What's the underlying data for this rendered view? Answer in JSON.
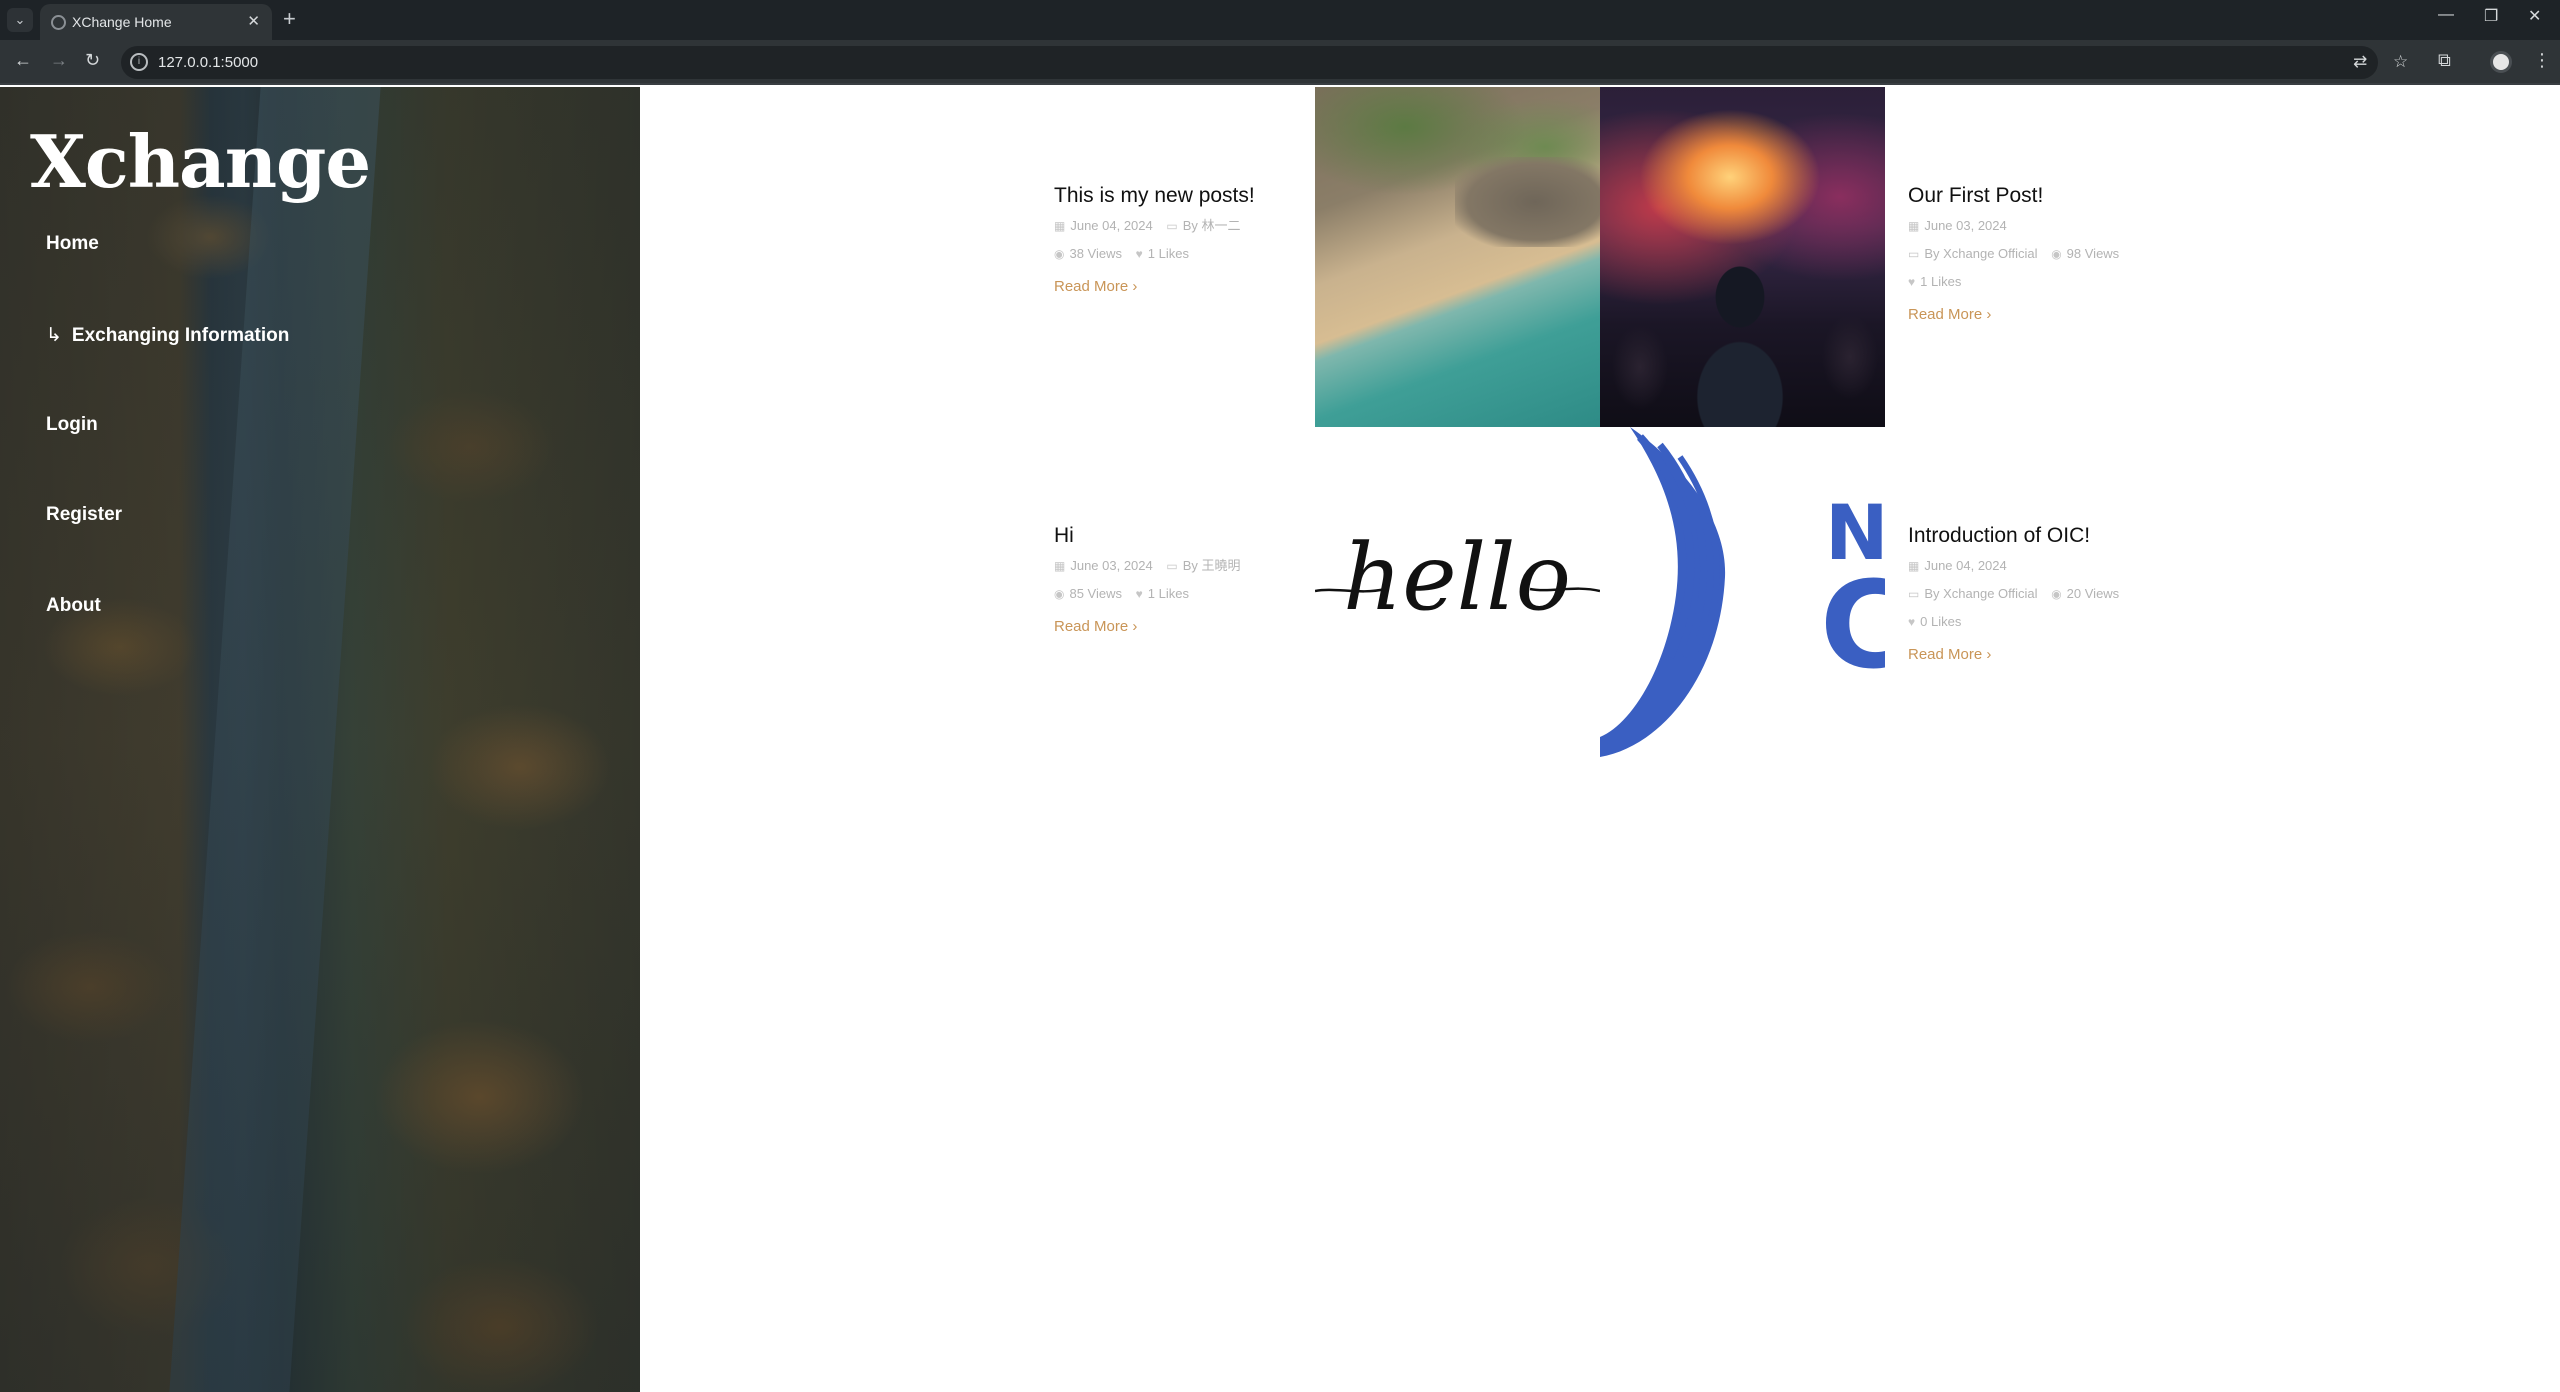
{
  "browser": {
    "tab_title": "XChange Home",
    "url": "127.0.0.1:5000"
  },
  "sidebar": {
    "brand": "Xchange",
    "nav": [
      {
        "label": "Home"
      },
      {
        "label": "Exchanging Information",
        "prefix": "↳"
      },
      {
        "label": "Login"
      },
      {
        "label": "Register"
      },
      {
        "label": "About"
      }
    ]
  },
  "posts": [
    {
      "title": "This is my new posts!",
      "date": "June 04, 2024",
      "author": "By 林一二",
      "views": "38 Views",
      "likes": "1 Likes",
      "read_more": "Read More"
    },
    {
      "title": "Our First Post!",
      "date": "June 03, 2024",
      "author": "By Xchange Official",
      "views": "98 Views",
      "likes": "1 Likes",
      "read_more": "Read More"
    },
    {
      "title": "Hi",
      "date": "June 03, 2024",
      "author": "By 王曉明",
      "views": "85 Views",
      "likes": "1 Likes",
      "read_more": "Read More",
      "image_text": "hello"
    },
    {
      "title": "Introduction of OIC!",
      "date": "June 04, 2024",
      "author": "By Xchange Official",
      "views": "20 Views",
      "likes": "0 Likes",
      "read_more": "Read More"
    }
  ],
  "colors": {
    "accent": "#c99557",
    "logo_blue": "#3a5fc2"
  }
}
